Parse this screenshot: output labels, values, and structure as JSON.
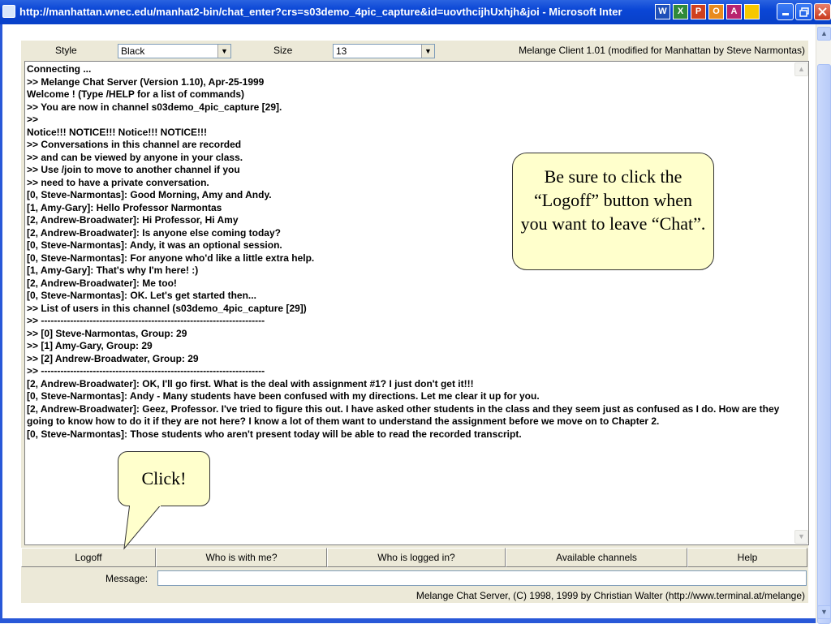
{
  "window": {
    "title": "http://manhattan.wnec.edu/manhat2-bin/chat_enter?crs=s03demo_4pic_capture&id=uovthcijhUxhjh&joi - Microsoft Inter",
    "taskbar_icons": [
      "W",
      "X",
      "P",
      "O",
      "A"
    ]
  },
  "toolbar": {
    "style_label": "Style",
    "style_value": "Black",
    "size_label": "Size",
    "size_value": "13",
    "client_version": "Melange Client 1.01 (modified for Manhattan by Steve Narmontas)"
  },
  "chat": {
    "lines": [
      "Connecting ...",
      ">> Melange Chat Server (Version 1.10), Apr-25-1999",
      "Welcome ! (Type /HELP for a list of commands)",
      ">> You are now in channel s03demo_4pic_capture [29].",
      ">>",
      "Notice!!! NOTICE!!! Notice!!! NOTICE!!!",
      ">> Conversations in this channel are recorded",
      ">> and can be viewed by anyone in your class.",
      ">> Use /join to move to another channel if you",
      ">> need to have a private conversation.",
      "[0, Steve-Narmontas]: Good Morning, Amy and Andy.",
      "[1, Amy-Gary]: Hello Professor Narmontas",
      "[2, Andrew-Broadwater]: Hi Professor, Hi Amy",
      "[2, Andrew-Broadwater]: Is anyone else coming today?",
      "[0, Steve-Narmontas]: Andy, it was an optional session.",
      "[0, Steve-Narmontas]: For anyone who'd like a little extra help.",
      "[1, Amy-Gary]: That's why I'm here! :)",
      "[2, Andrew-Broadwater]: Me too!",
      "[0, Steve-Narmontas]: OK. Let's get started then...",
      ">> List of users in this channel (s03demo_4pic_capture [29])",
      ">> ---------------------------------------------------------------------",
      ">> [0] Steve-Narmontas, Group: 29",
      ">> [1] Amy-Gary, Group: 29",
      ">> [2] Andrew-Broadwater, Group: 29",
      ">> ---------------------------------------------------------------------",
      "[2, Andrew-Broadwater]: OK, I'll go first. What is the deal with assignment #1? I just don't get it!!!",
      "[0, Steve-Narmontas]: Andy - Many students have been confused with my directions. Let me clear it up for you.",
      "[2, Andrew-Broadwater]: Geez, Professor. I've tried to figure this out. I have asked other students in the class and they seem just as confused as I do. How are they going to know how to do it if they are not here? I know a lot of them want to understand the assignment before we move on to Chapter 2.",
      "[0, Steve-Narmontas]: Those students who aren't present today will be able to read the recorded transcript."
    ]
  },
  "buttons": {
    "logoff": "Logoff",
    "who_with_me": "Who is with me?",
    "who_logged_in": "Who is logged in?",
    "channels": "Available channels",
    "help": "Help"
  },
  "message": {
    "label": "Message:",
    "value": ""
  },
  "footer": "Melange Chat Server, (C) 1998, 1999 by Christian Walter  (http://www.terminal.at/melange)",
  "callouts": {
    "logoff_tip": "Be sure to click the “Logoff” button when you want to leave “Chat”.",
    "click": "Click!"
  },
  "colors": {
    "titlebar": "#0a46d6",
    "panel": "#ece9d8",
    "callout": "#ffffcc"
  }
}
